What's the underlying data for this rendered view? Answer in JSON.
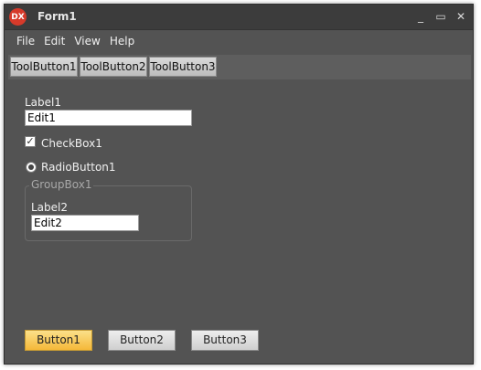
{
  "window": {
    "title": "Form1",
    "icon_text": "DX",
    "icon": "dx-logo-icon"
  },
  "window_controls": {
    "minimize": "_",
    "maximize": "▭",
    "close": "✕"
  },
  "menu": [
    "File",
    "Edit",
    "View",
    "Help"
  ],
  "toolbar": [
    "ToolButton1",
    "ToolButton2",
    "ToolButton3"
  ],
  "form": {
    "label1": "Label1",
    "edit1": "Edit1",
    "checkbox1": {
      "label": "CheckBox1",
      "checked": true
    },
    "radiobutton1": {
      "label": "RadioButton1",
      "selected": true
    },
    "groupbox1": {
      "caption": "GroupBox1",
      "label2": "Label2",
      "edit2": "Edit2"
    }
  },
  "buttons": [
    "Button1",
    "Button2",
    "Button3"
  ],
  "colors": {
    "form_background": "#535353",
    "titlebar": "#3c3c3c",
    "primary_button": "#f5b838",
    "icon_red": "#d63a2a"
  }
}
